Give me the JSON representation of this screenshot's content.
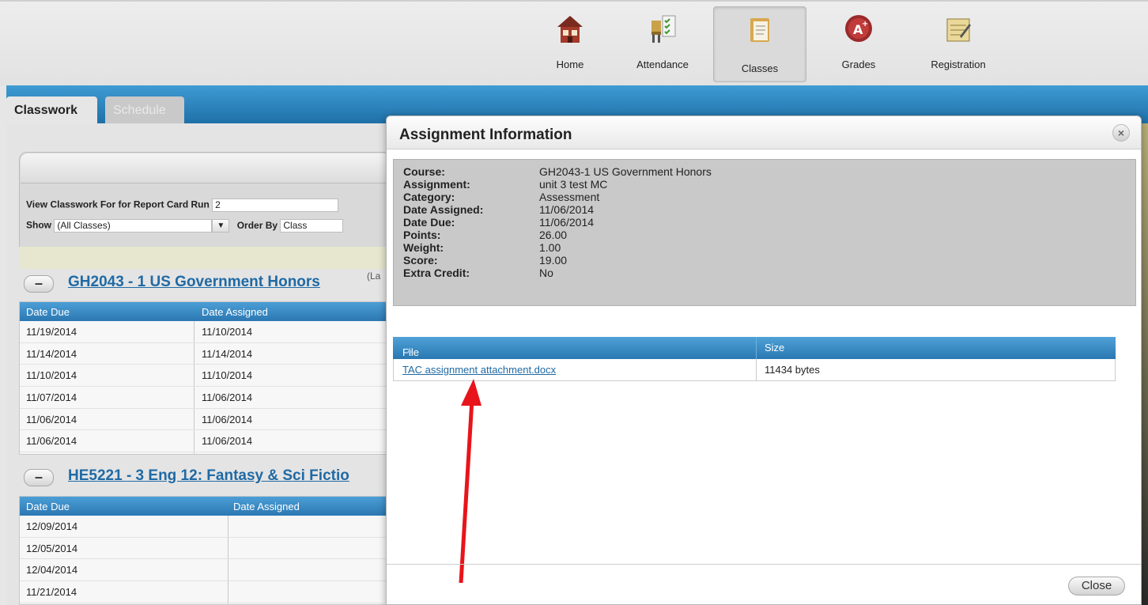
{
  "nav": {
    "home": "Home",
    "attendance": "Attendance",
    "classes": "Classes",
    "grades": "Grades",
    "registration": "Registration"
  },
  "tabs": {
    "classwork": "Classwork",
    "schedule": "Schedule"
  },
  "filters": {
    "report_card_label": "View Classwork For for Report Card Run",
    "report_card_value": "2",
    "show_label": "Show",
    "show_value": "(All Classes)",
    "order_by_label": "Order By",
    "order_by_value": "Class"
  },
  "groups": [
    {
      "title": "GH2043 - 1 US Government Honors",
      "suffix": "(La",
      "columns": [
        "Date Due",
        "Date Assigned"
      ],
      "rows": [
        [
          "11/19/2014",
          "11/10/2014"
        ],
        [
          "11/14/2014",
          "11/14/2014"
        ],
        [
          "11/10/2014",
          "11/10/2014"
        ],
        [
          "11/07/2014",
          "11/06/2014"
        ],
        [
          "11/06/2014",
          "11/06/2014"
        ],
        [
          "11/06/2014",
          "11/06/2014"
        ]
      ]
    },
    {
      "title": "HE5221 - 3 Eng 12: Fantasy & Sci Fictio",
      "columns": [
        "Date Due",
        "Date Assigned"
      ],
      "rows": [
        [
          "12/09/2014",
          ""
        ],
        [
          "12/05/2014",
          ""
        ],
        [
          "12/04/2014",
          ""
        ],
        [
          "11/21/2014",
          ""
        ]
      ]
    }
  ],
  "modal": {
    "title": "Assignment Information",
    "close_x": "×",
    "fields": [
      {
        "label": "Course:",
        "value": "GH2043-1 US Government Honors"
      },
      {
        "label": "Assignment:",
        "value": "unit 3 test MC"
      },
      {
        "label": "Category:",
        "value": "Assessment"
      },
      {
        "label": "Date Assigned:",
        "value": "11/06/2014"
      },
      {
        "label": "Date Due:",
        "value": "11/06/2014"
      },
      {
        "label": "Points:",
        "value": "26.00"
      },
      {
        "label": "Weight:",
        "value": "1.00"
      },
      {
        "label": "Score:",
        "value": "19.00"
      },
      {
        "label": "Extra Credit:",
        "value": "No"
      }
    ],
    "file_table": {
      "columns": [
        "File",
        "Size"
      ],
      "rows": [
        {
          "file": "TAC assignment attachment.docx",
          "size": "11434 bytes"
        }
      ]
    },
    "close_button": "Close"
  },
  "colors": {
    "accent_blue": "#2b77b2",
    "link_blue": "#1f6aa5",
    "annotation_arrow": "#e8141b"
  }
}
